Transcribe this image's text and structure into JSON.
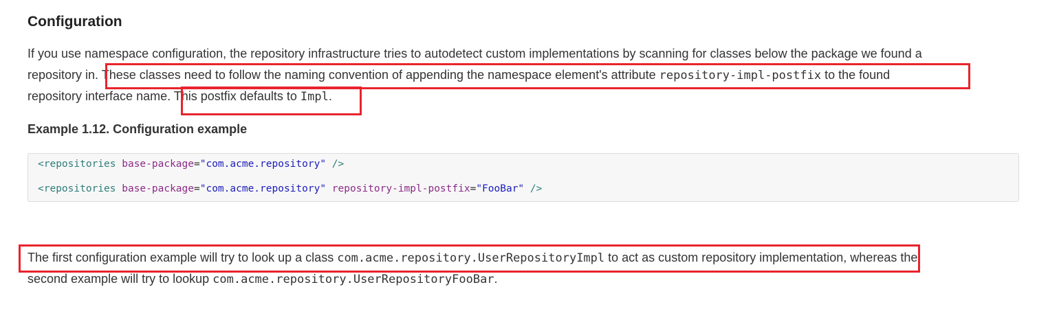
{
  "heading": "Configuration",
  "intro": {
    "line1": "If you use namespace configuration, the repository infrastructure tries to autodetect custom implementations by scanning for classes below the package we found a",
    "line2_a": "repository in. ",
    "line2_b": "These classes need to follow the naming convention of appending the namespace element's attribute ",
    "line2_code": "repository-impl-postfix",
    "line2_c": " to the found",
    "line3_a": "repository interface name. ",
    "line3_b": "This postfix defaults to ",
    "line3_code": "Impl",
    "line3_c": "."
  },
  "example_title": "Example 1.12. Configuration example",
  "code": {
    "line1": {
      "open": "<repositories",
      "attr1": " base-package",
      "eq1": "=",
      "val1": "\"com.acme.repository\"",
      "close": " />"
    },
    "line2": {
      "open": "<repositories",
      "attr1": " base-package",
      "eq1": "=",
      "val1": "\"com.acme.repository\"",
      "attr2": " repository-impl-postfix",
      "eq2": "=",
      "val2": "\"FooBar\"",
      "close": " />"
    }
  },
  "outro": {
    "line1_a": "The first configuration example will try to look up a class ",
    "line1_code": "com.acme.repository.UserRepositoryImpl",
    "line1_b": " to act as custom repository implementation",
    "line1_c": ", whereas the",
    "line2_a": "second example will try to lookup ",
    "line2_code": "com.acme.repository.UserRepositoryFooBar",
    "line2_b": "."
  },
  "highlight_color": "#e8232b"
}
